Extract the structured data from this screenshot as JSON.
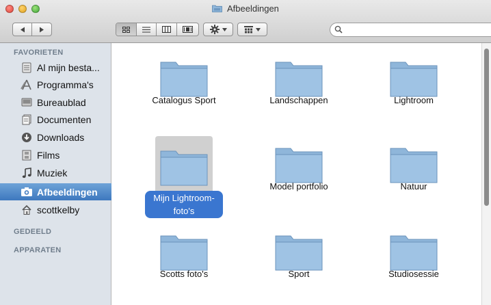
{
  "window": {
    "title": "Afbeeldingen"
  },
  "toolbar": {
    "back_label": "◀",
    "forward_label": "▶",
    "search_placeholder": ""
  },
  "sidebar": {
    "sections": {
      "favorites": "FAVORIETEN",
      "shared": "GEDEELD",
      "devices": "APPARATEN"
    },
    "items": [
      {
        "label": "Al mijn besta...",
        "icon": "all-files-icon"
      },
      {
        "label": "Programma's",
        "icon": "applications-icon"
      },
      {
        "label": "Bureaublad",
        "icon": "desktop-icon"
      },
      {
        "label": "Documenten",
        "icon": "documents-icon"
      },
      {
        "label": "Downloads",
        "icon": "downloads-icon"
      },
      {
        "label": "Films",
        "icon": "movies-icon"
      },
      {
        "label": "Muziek",
        "icon": "music-icon"
      },
      {
        "label": "Afbeeldingen",
        "icon": "camera-icon",
        "selected": true
      },
      {
        "label": "scottkelby",
        "icon": "home-icon"
      }
    ]
  },
  "content": {
    "items": [
      {
        "label": "Catalogus Sport"
      },
      {
        "label": "Landschappen"
      },
      {
        "label": "Lightroom"
      },
      {
        "label": "Mijn Lightroom-",
        "label2": "foto's",
        "selected": true
      },
      {
        "label": "Model portfolio"
      },
      {
        "label": "Natuur"
      },
      {
        "label": "Scotts foto's"
      },
      {
        "label": "Sport"
      },
      {
        "label": "Studiosessie"
      }
    ]
  },
  "colors": {
    "sidebar_bg": "#dde3ea",
    "selection": "#3d78be",
    "folder": "#8fb6da"
  }
}
